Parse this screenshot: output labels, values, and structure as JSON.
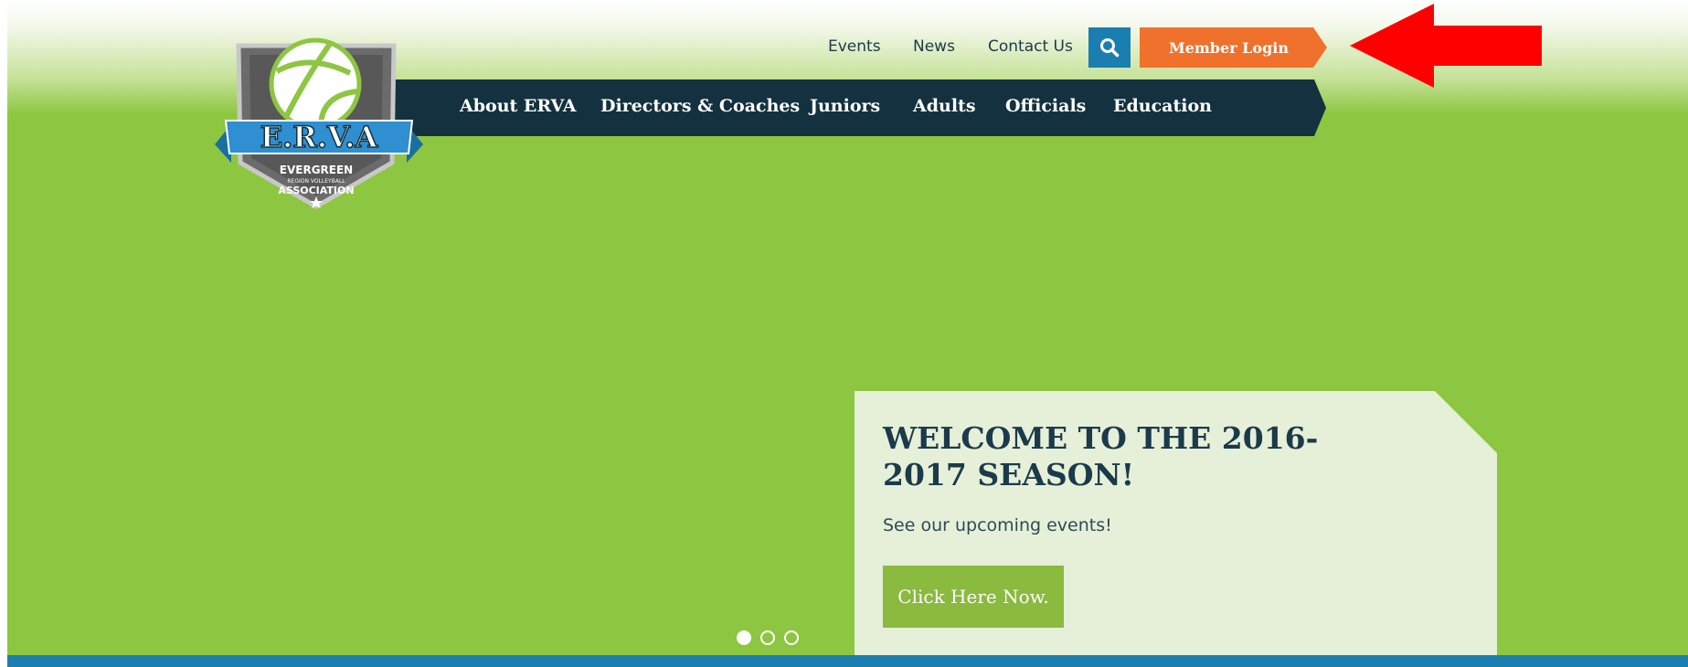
{
  "utility_nav": {
    "events": "Events",
    "news": "News",
    "contact": "Contact Us",
    "login": "Member Login"
  },
  "logo": {
    "wordmark": "E.R.V.A",
    "line1": "EVERGREEN",
    "line2": "REGION VOLLEYBALL",
    "line3": "ASSOCIATION"
  },
  "main_nav": {
    "about": "About ERVA",
    "directors": "Directors & Coaches",
    "juniors": "Juniors",
    "adults": "Adults",
    "officials": "Officials",
    "education": "Education"
  },
  "hero": {
    "title": "WELCOME TO THE 2016-2017 SEASON!",
    "subtitle": "See our upcoming events!",
    "cta": "Click Here Now."
  },
  "carousel": {
    "active_index": 0
  },
  "colors": {
    "brand_green": "#8dc641",
    "nav_dark": "#13313f",
    "accent_orange": "#f0712b",
    "accent_blue": "#1a7fb0",
    "annotation_red": "#ff0000"
  },
  "icons": {
    "search": "magnifier",
    "annotation": "red-left-arrow"
  }
}
